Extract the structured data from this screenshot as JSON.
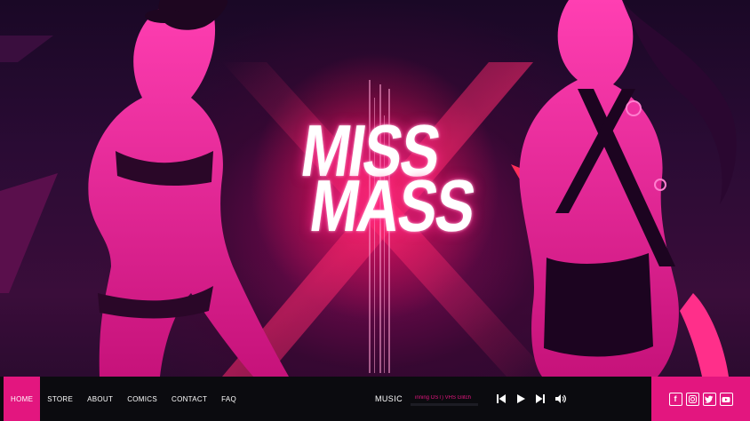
{
  "logo": {
    "line1": "MISS",
    "line2": "MASS"
  },
  "nav": {
    "items": [
      {
        "label": "HOME",
        "active": true
      },
      {
        "label": "STORE"
      },
      {
        "label": "ABOUT"
      },
      {
        "label": "COMICS"
      },
      {
        "label": "CONTACT"
      },
      {
        "label": "FAQ"
      }
    ]
  },
  "player": {
    "label": "MUSIC",
    "track": "inning OST) VHS Glitch",
    "progress": 0.0,
    "controls": [
      "previous-icon",
      "play-icon",
      "next-icon",
      "volume-icon"
    ]
  },
  "social": {
    "icons": [
      "facebook-icon",
      "instagram-icon",
      "twitter-icon",
      "youtube-icon"
    ]
  },
  "colors": {
    "accent": "#e3167f",
    "bar": "#0b0b0f",
    "background": "#2a0b34"
  }
}
